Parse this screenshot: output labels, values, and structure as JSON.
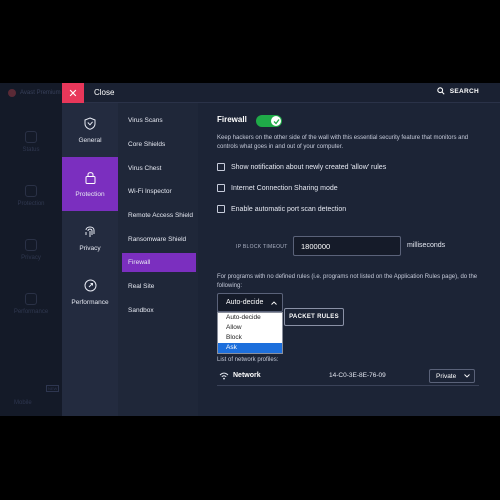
{
  "background_app": {
    "title": "Avast Premium",
    "items": [
      "Status",
      "Protection",
      "Privacy",
      "Performance"
    ],
    "bottom_label": "Mobile",
    "badge": "NEW"
  },
  "topbar": {
    "close_label": "Close",
    "search_label": "SEARCH"
  },
  "nav": {
    "items": [
      {
        "label": "General",
        "icon": "shield-outline-icon"
      },
      {
        "label": "Protection",
        "icon": "lock-icon",
        "active": true
      },
      {
        "label": "Privacy",
        "icon": "fingerprint-icon"
      },
      {
        "label": "Performance",
        "icon": "rocket-icon"
      }
    ]
  },
  "subnav": {
    "items": [
      "Virus Scans",
      "Core Shields",
      "Virus Chest",
      "Wi-Fi Inspector",
      "Remote Access Shield",
      "Ransomware Shield",
      "Firewall",
      "Real Site",
      "Sandbox"
    ],
    "active": "Firewall"
  },
  "firewall": {
    "title": "Firewall",
    "enabled": true,
    "description": "Keep hackers on the other side of the wall with this essential security feature that monitors and controls what goes in and out of your computer.",
    "options": [
      {
        "label": "Show notification about newly created 'allow' rules",
        "checked": false
      },
      {
        "label": "Internet Connection Sharing mode",
        "checked": false
      },
      {
        "label": "Enable automatic port scan detection",
        "checked": false
      }
    ],
    "ip_block_label": "IP BLOCK TIMEOUT",
    "ip_block_value": "1800000",
    "ip_block_unit": "milliseconds",
    "rules_description": "For programs with no defined rules (i.e. programs not listed on the Application Rules page), do the following:",
    "rule_select_value": "Auto-decide",
    "rule_options": [
      "Auto-decide",
      "Allow",
      "Block",
      "Ask"
    ],
    "rule_highlighted": "Ask",
    "packet_rules_label": "PACKET RULES",
    "profiles_label": "List of network profiles:",
    "networks": [
      {
        "name": "Network",
        "mac": "14-C0-3E-8E-76-09",
        "profile": "Private"
      }
    ]
  },
  "colors": {
    "accent": "#7b2fbf",
    "close": "#e8375a",
    "toggle_on": "#1faa48",
    "bg": "#1c2436"
  }
}
